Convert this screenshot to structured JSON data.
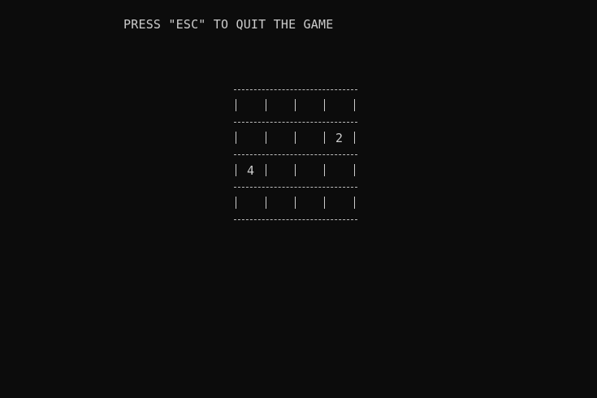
{
  "instruction": "PRESS \"ESC\" TO QUIT THE GAME",
  "board": {
    "rows": [
      [
        "",
        "",
        "",
        ""
      ],
      [
        "",
        "",
        "",
        "2"
      ],
      [
        "4",
        "",
        "",
        ""
      ],
      [
        "",
        "",
        "",
        ""
      ]
    ]
  },
  "colors": {
    "background": "#0c0c0c",
    "text": "#cccccc"
  }
}
